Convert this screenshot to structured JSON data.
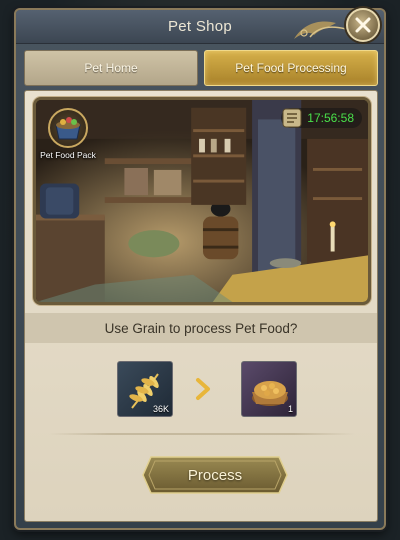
{
  "window": {
    "title": "Pet Shop"
  },
  "tabs": [
    {
      "label": "Pet Home",
      "active": false
    },
    {
      "label": "Pet Food Processing",
      "active": true
    }
  ],
  "scene": {
    "pack_label": "Pet Food Pack",
    "timer": "17:56:58"
  },
  "prompt": "Use Grain to process Pet Food?",
  "input_item": {
    "icon": "grain-icon",
    "quantity": "36K"
  },
  "output_item": {
    "icon": "pet-food-bowl-icon",
    "quantity": "1"
  },
  "process_button": {
    "label": "Process"
  },
  "colors": {
    "accent_gold": "#c9a24a",
    "timer_green": "#49e04a",
    "panel_bg": "#e9e1cf"
  }
}
